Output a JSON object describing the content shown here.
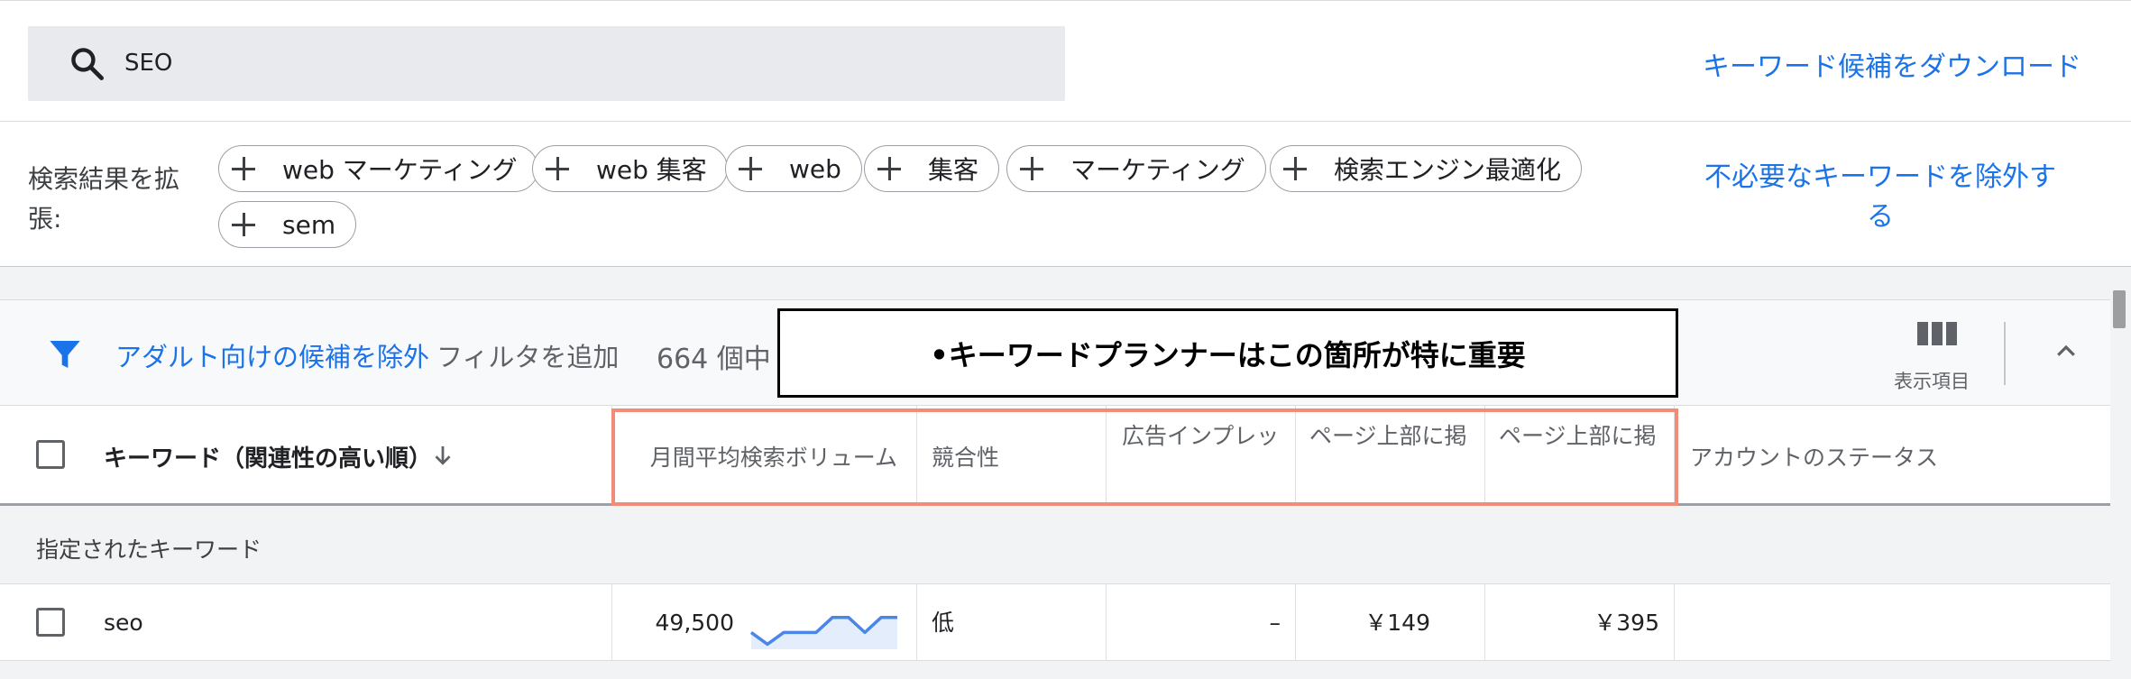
{
  "search": {
    "value": "SEO"
  },
  "header": {
    "download_link": "キーワード候補をダウンロード"
  },
  "expand": {
    "label": "検索結果を拡張:",
    "chips": [
      "web マーケティング",
      "web 集客",
      "web",
      "集客",
      "マーケティング",
      "検索エンジン最適化",
      "sem"
    ],
    "exclude_link": "不必要なキーワードを除外する"
  },
  "filterbar": {
    "adult_filter": "アダルト向けの候補を除外",
    "add_filter": "フィルタを追加",
    "count": "664 個中",
    "callout": "•キーワードプランナーはこの箇所が特に重要",
    "columns_label": "表示項目"
  },
  "table": {
    "columns": {
      "keyword": "キーワード（関連性の高い順）",
      "avg_monthly": "月間平均検索ボリューム",
      "competition": "競合性",
      "impression_share": "広告インプレッ",
      "top_bid_low": "ページ上部に掲",
      "top_bid_high": "ページ上部に掲",
      "account_status": "アカウントのステータス"
    },
    "section_label": "指定されたキーワード",
    "rows": [
      {
        "keyword": "seo",
        "avg_monthly": "49,500",
        "competition": "低",
        "impression_share": "–",
        "top_bid_low": "￥149",
        "top_bid_high": "￥395",
        "trend": [
          0.3,
          0.05,
          0.3,
          0.3,
          0.3,
          0.62,
          0.62,
          0.3,
          0.62,
          0.62
        ]
      }
    ]
  },
  "colors": {
    "link": "#1a73e8",
    "highlight_border": "#f28b77",
    "trend_line": "#4a86e8",
    "trend_fill": "#e3edfb"
  },
  "icons": [
    "search-icon",
    "filter-icon",
    "columns-icon",
    "chevron-up-icon",
    "arrow-down-icon",
    "plus-icon"
  ]
}
